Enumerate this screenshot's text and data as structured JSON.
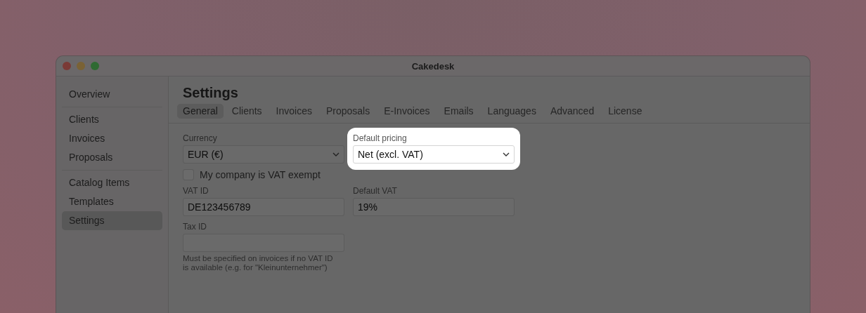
{
  "window": {
    "title": "Cakedesk"
  },
  "sidebar": {
    "groups": [
      {
        "items": [
          {
            "label": "Overview",
            "selected": false
          }
        ]
      },
      {
        "items": [
          {
            "label": "Clients",
            "selected": false
          },
          {
            "label": "Invoices",
            "selected": false
          },
          {
            "label": "Proposals",
            "selected": false
          }
        ]
      },
      {
        "items": [
          {
            "label": "Catalog Items",
            "selected": false
          },
          {
            "label": "Templates",
            "selected": false
          },
          {
            "label": "Settings",
            "selected": true
          }
        ]
      }
    ]
  },
  "page": {
    "title": "Settings"
  },
  "tabs": [
    {
      "label": "General",
      "selected": true
    },
    {
      "label": "Clients",
      "selected": false
    },
    {
      "label": "Invoices",
      "selected": false
    },
    {
      "label": "Proposals",
      "selected": false
    },
    {
      "label": "E-Invoices",
      "selected": false
    },
    {
      "label": "Emails",
      "selected": false
    },
    {
      "label": "Languages",
      "selected": false
    },
    {
      "label": "Advanced",
      "selected": false
    },
    {
      "label": "License",
      "selected": false
    }
  ],
  "form": {
    "rows": [
      {
        "kind": "fields",
        "fields": [
          {
            "kind": "select",
            "label": "Currency",
            "value": "EUR (€)",
            "highlighted": false
          },
          {
            "kind": "select",
            "label": "Default pricing",
            "value": "Net (excl. VAT)",
            "highlighted": true
          }
        ]
      },
      {
        "kind": "checkbox",
        "label": "My company is VAT exempt",
        "checked": false
      },
      {
        "kind": "fields",
        "fields": [
          {
            "kind": "text",
            "label": "VAT ID",
            "value": "DE123456789",
            "highlighted": false
          },
          {
            "kind": "text",
            "label": "Default VAT",
            "value": "19%",
            "highlighted": false
          }
        ]
      },
      {
        "kind": "fields",
        "fields": [
          {
            "kind": "text",
            "label": "Tax ID",
            "highlighted": false,
            "note": "Must be specified on invoices if no VAT ID is available (e.g. for \"Kleinunternehmer\")"
          }
        ]
      }
    ]
  }
}
